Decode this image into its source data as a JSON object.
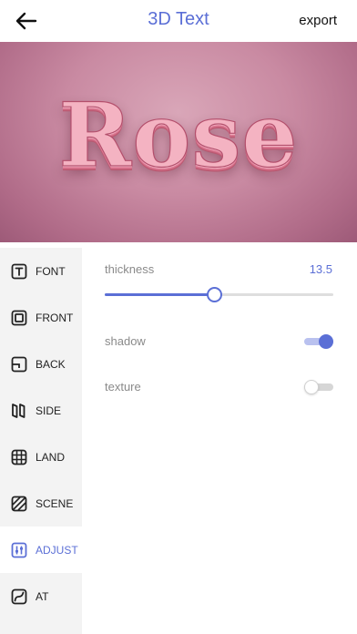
{
  "header": {
    "title": "3D Text",
    "export_label": "export",
    "back_icon": "arrow-left-icon"
  },
  "preview": {
    "text": "Rose"
  },
  "sidebar": {
    "items": [
      {
        "label": "FONT",
        "icon": "font-icon",
        "active": false
      },
      {
        "label": "FRONT",
        "icon": "front-face-icon",
        "active": false
      },
      {
        "label": "BACK",
        "icon": "back-face-icon",
        "active": false
      },
      {
        "label": "SIDE",
        "icon": "side-icon",
        "active": false
      },
      {
        "label": "LAND",
        "icon": "grid-icon",
        "active": false
      },
      {
        "label": "SCENE",
        "icon": "scene-icon",
        "active": false
      },
      {
        "label": "ADJUST",
        "icon": "adjust-icon",
        "active": true
      },
      {
        "label": "AT",
        "icon": "curve-icon",
        "active": false
      }
    ]
  },
  "adjust": {
    "thickness": {
      "label": "thickness",
      "value": "13.5",
      "fraction": 0.48
    },
    "shadow": {
      "label": "shadow",
      "on": true
    },
    "texture": {
      "label": "texture",
      "on": false
    }
  },
  "colors": {
    "accent": "#5b6fd6",
    "sidebar_bg": "#f3f3f3"
  }
}
